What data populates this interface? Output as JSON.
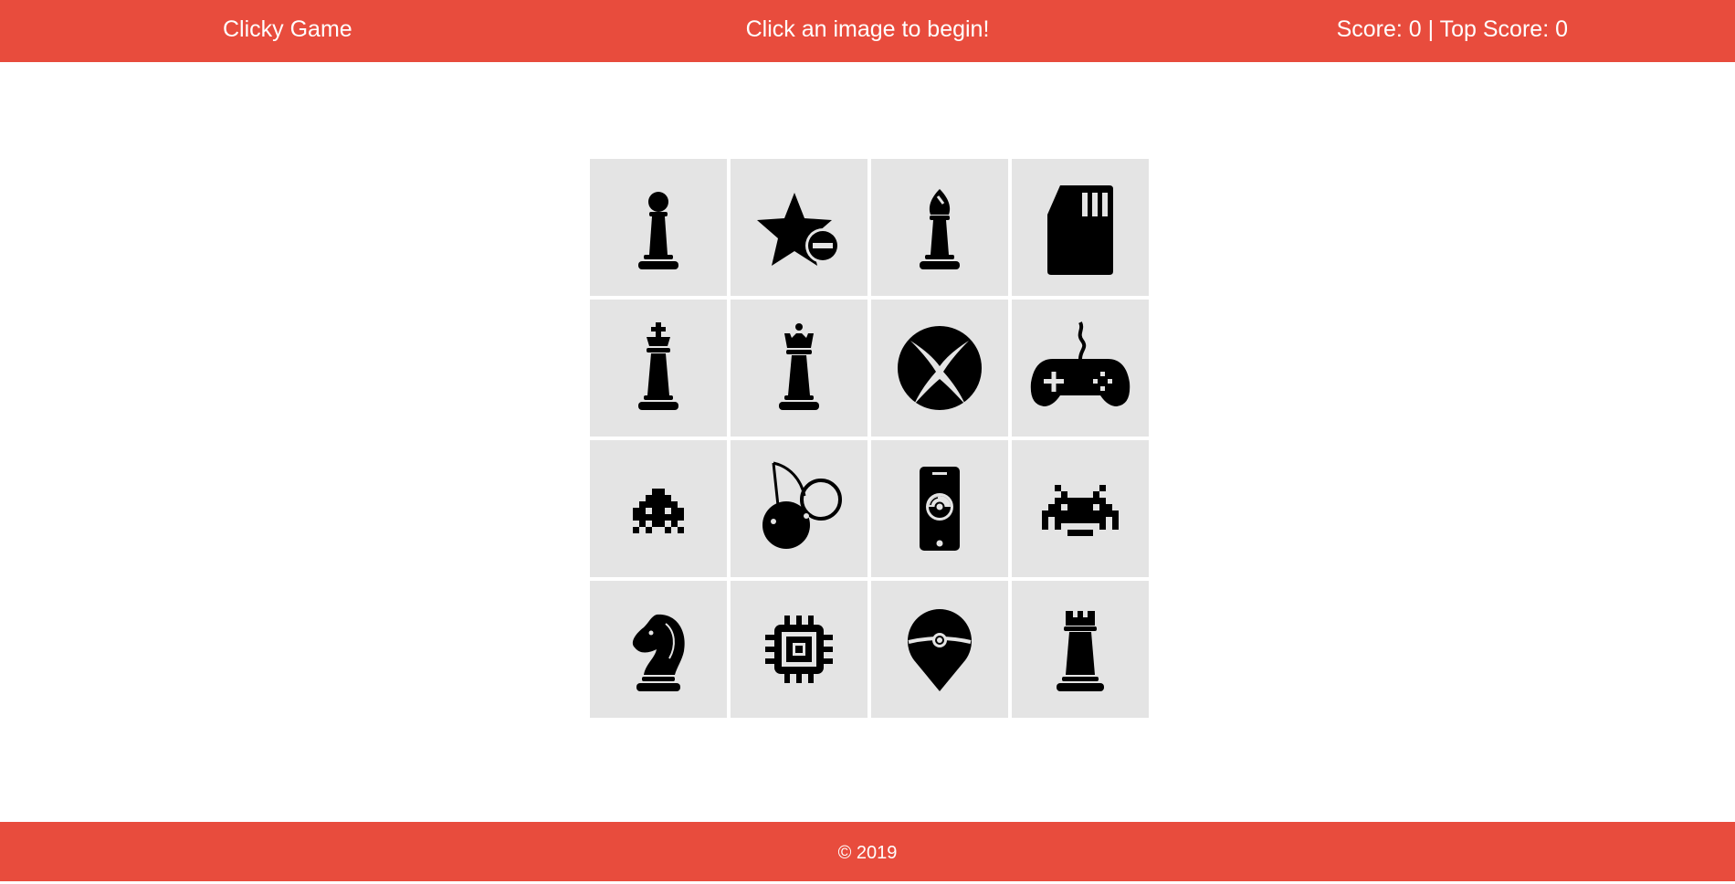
{
  "header": {
    "brand": "Clicky Game",
    "message": "Click an image to begin!",
    "score_text": "Score: 0 | Top Score: 0"
  },
  "colors": {
    "bar": "#e84c3d",
    "tile": "#e4e4e4",
    "icon": "#000000"
  },
  "cards": [
    {
      "icon": "chess-pawn-icon"
    },
    {
      "icon": "star-minus-icon"
    },
    {
      "icon": "chess-bishop-icon"
    },
    {
      "icon": "sd-card-icon"
    },
    {
      "icon": "chess-king-icon"
    },
    {
      "icon": "chess-queen-icon"
    },
    {
      "icon": "xbox-icon"
    },
    {
      "icon": "gamepad-icon"
    },
    {
      "icon": "space-invader-icon"
    },
    {
      "icon": "cherries-icon"
    },
    {
      "icon": "pokemon-go-phone-icon"
    },
    {
      "icon": "alien-invader-icon"
    },
    {
      "icon": "chess-knight-icon"
    },
    {
      "icon": "microchip-icon"
    },
    {
      "icon": "pokeball-pin-icon"
    },
    {
      "icon": "chess-rook-icon"
    }
  ],
  "footer": {
    "copyright": "© 2019"
  }
}
